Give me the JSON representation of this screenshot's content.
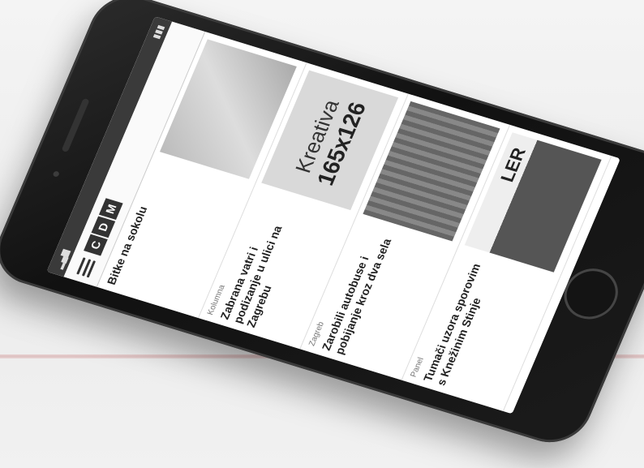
{
  "logo": {
    "letters": [
      "C",
      "D",
      "M"
    ]
  },
  "featured": {
    "title": "Bitke na sokolu"
  },
  "banner": {
    "title": "Kreativa",
    "size": "165x126"
  },
  "articles": [
    {
      "category": "Kolumna",
      "headline": "Zabrana vatri i podizanje u ulici na Zagrebu"
    },
    {
      "category": "Zagreb",
      "headline": "Zarobili autobuse i pobijanje kroz dva sela"
    },
    {
      "category": "Panel",
      "headline": "Tumači uzora sporovim s Knežinim Stinje"
    }
  ],
  "sign_text": "LER"
}
